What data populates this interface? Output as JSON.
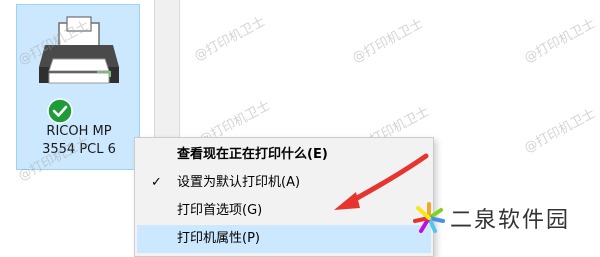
{
  "printer": {
    "name_line1": "RICOH MP",
    "name_line2": "3554 PCL 6",
    "status_icon": "checkmark-circle-icon"
  },
  "context_menu": {
    "items": [
      {
        "label": "查看现在正在打印什么(E)",
        "bold": true,
        "checked": false
      },
      {
        "label": "设置为默认打印机(A)",
        "bold": false,
        "checked": true
      },
      {
        "label": "打印首选项(G)",
        "bold": false,
        "checked": false
      },
      {
        "label": "打印机属性(P)",
        "bold": false,
        "checked": false,
        "highlighted": true
      }
    ]
  },
  "watermark_text": "@打印机卫士",
  "brand": {
    "name": "二泉软件园",
    "logo_icon": "starburst-logo-icon"
  },
  "colors": {
    "selection": "#cce8ff",
    "arrow": "#e8342e",
    "badge": "#1e9c3a"
  }
}
